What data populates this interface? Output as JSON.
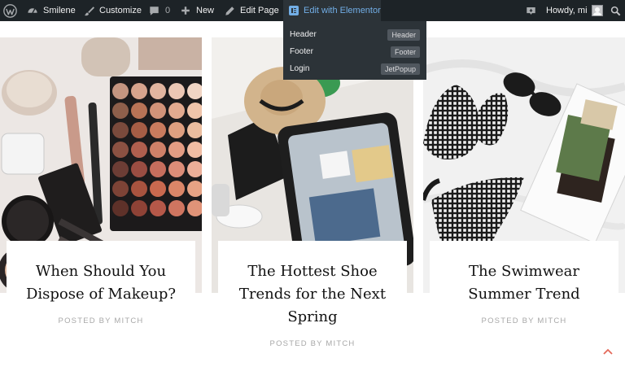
{
  "adminbar": {
    "site_name": "Smilene",
    "customize": "Customize",
    "comments_count": "0",
    "new": "New",
    "edit_page": "Edit Page",
    "elementor": "Edit with Elementor",
    "greeting": "Howdy, mi"
  },
  "dropdown": {
    "items": [
      {
        "label": "Header",
        "badge": "Header"
      },
      {
        "label": "Footer",
        "badge": "Footer"
      },
      {
        "label": "Login",
        "badge": "JetPopup"
      }
    ]
  },
  "posts": [
    {
      "title": "When Should You Dispose of Makeup?",
      "meta": "POSTED BY MITCH"
    },
    {
      "title": "The Hottest Shoe Trends for the Next Spring",
      "meta": "POSTED BY MITCH"
    },
    {
      "title": "The Swimwear Summer Trend",
      "meta": "POSTED BY MITCH"
    }
  ],
  "colors": {
    "adminbar_bg": "#1d2327",
    "dropdown_bg": "#2c3338",
    "accent_link": "#72aee6",
    "scroll_top": "#e46a5a"
  },
  "icons": {
    "logo": "wordpress-icon",
    "site": "dashboard-icon",
    "customize": "brush-icon",
    "comments": "comment-icon",
    "new": "plus-icon",
    "edit": "pencil-icon",
    "elementor": "elementor-icon",
    "notifications": "notification-icon",
    "search": "search-icon",
    "scroll_top": "chevron-up-icon"
  }
}
